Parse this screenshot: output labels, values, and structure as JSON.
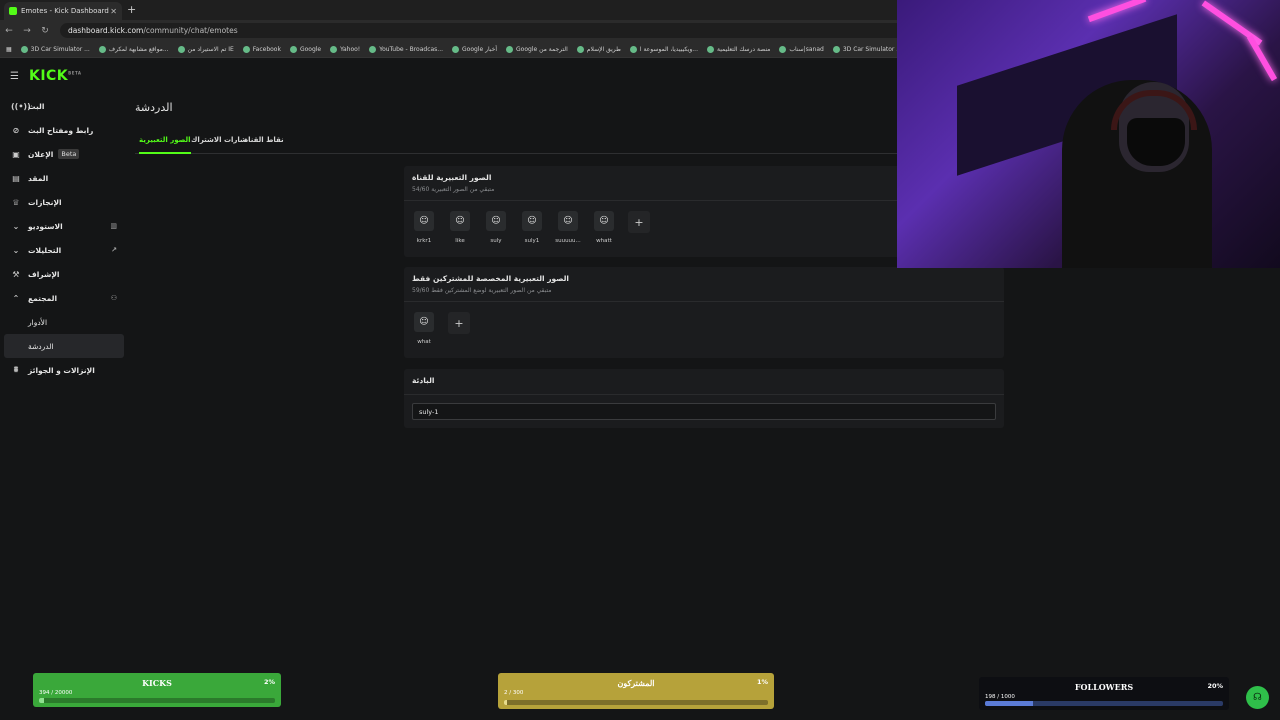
{
  "browser": {
    "tab_title": "Emotes - Kick Dashboard",
    "url_host": "dashboard.kick.com",
    "url_path": "/community/chat/emotes",
    "bookmarks": [
      "3D Car Simulator ...",
      "مواقع مشابهة لمكرف...",
      "تم الاستيراد من IE",
      "Facebook",
      "Google",
      "Yahoo!",
      "YouTube - Broadcas...",
      "Google أخبار",
      "Google الترجمة من",
      "طريق الإسلام",
      "ويكيبيديا، الموسوعة ا...",
      "منصة درسك التعليمية",
      "سناب|sanad",
      "3D Car Simulator ..."
    ]
  },
  "sidebar": {
    "logo": "KICK",
    "logo_badge": "BETA",
    "items": [
      {
        "label": "البث"
      },
      {
        "label": "رابط ومفتاح البث"
      },
      {
        "label": "الإعلان",
        "badge": "Beta"
      },
      {
        "label": "المقد"
      },
      {
        "label": "الإنجازات"
      },
      {
        "label": "الاستوديو"
      },
      {
        "label": "التحليلات"
      },
      {
        "label": "الإشراف"
      },
      {
        "label": "المجتمع"
      },
      {
        "label": "الأدوار"
      },
      {
        "label": "الدردشة"
      },
      {
        "label": "الإنزالات و الجوائز"
      }
    ]
  },
  "main": {
    "page_title": "الدردشة",
    "tabs": [
      "الصور التعبيرية",
      "شارات الاشتراك",
      "نقاط القناة"
    ]
  },
  "channel_emotes": {
    "title": "الصور التعبيرية للقناة",
    "count": "54/60",
    "subtitle": "متبقي من الصور التعبيرية",
    "items": [
      "krkr1",
      "like",
      "suly",
      "suly1",
      "suuuuu...",
      "whatt"
    ]
  },
  "subscriber_emotes": {
    "title": "الصور التعبيرية المخصصة للمشتركين فقط",
    "count": "59/60",
    "subtitle": "متبقي من الصور التعبيرية لوضع المشتركين فقط",
    "items": [
      "what"
    ]
  },
  "prefix": {
    "title": "البادئة",
    "value": "suly-1"
  },
  "goals": {
    "kicks": {
      "title": "KICKS",
      "percent_label": "2%",
      "count": "394 / 20000",
      "fill": 0.02,
      "color": "#2e8b2e"
    },
    "subs": {
      "title": "المشتركون",
      "percent_label": "1%",
      "count": "2 / 300",
      "fill": 0.01,
      "color": "#8a7a2e"
    },
    "followers": {
      "title": "FOLLOWERS",
      "percent_label": "20%",
      "count": "198 / 1000",
      "fill": 0.2,
      "color": "#1e2a4a"
    }
  }
}
